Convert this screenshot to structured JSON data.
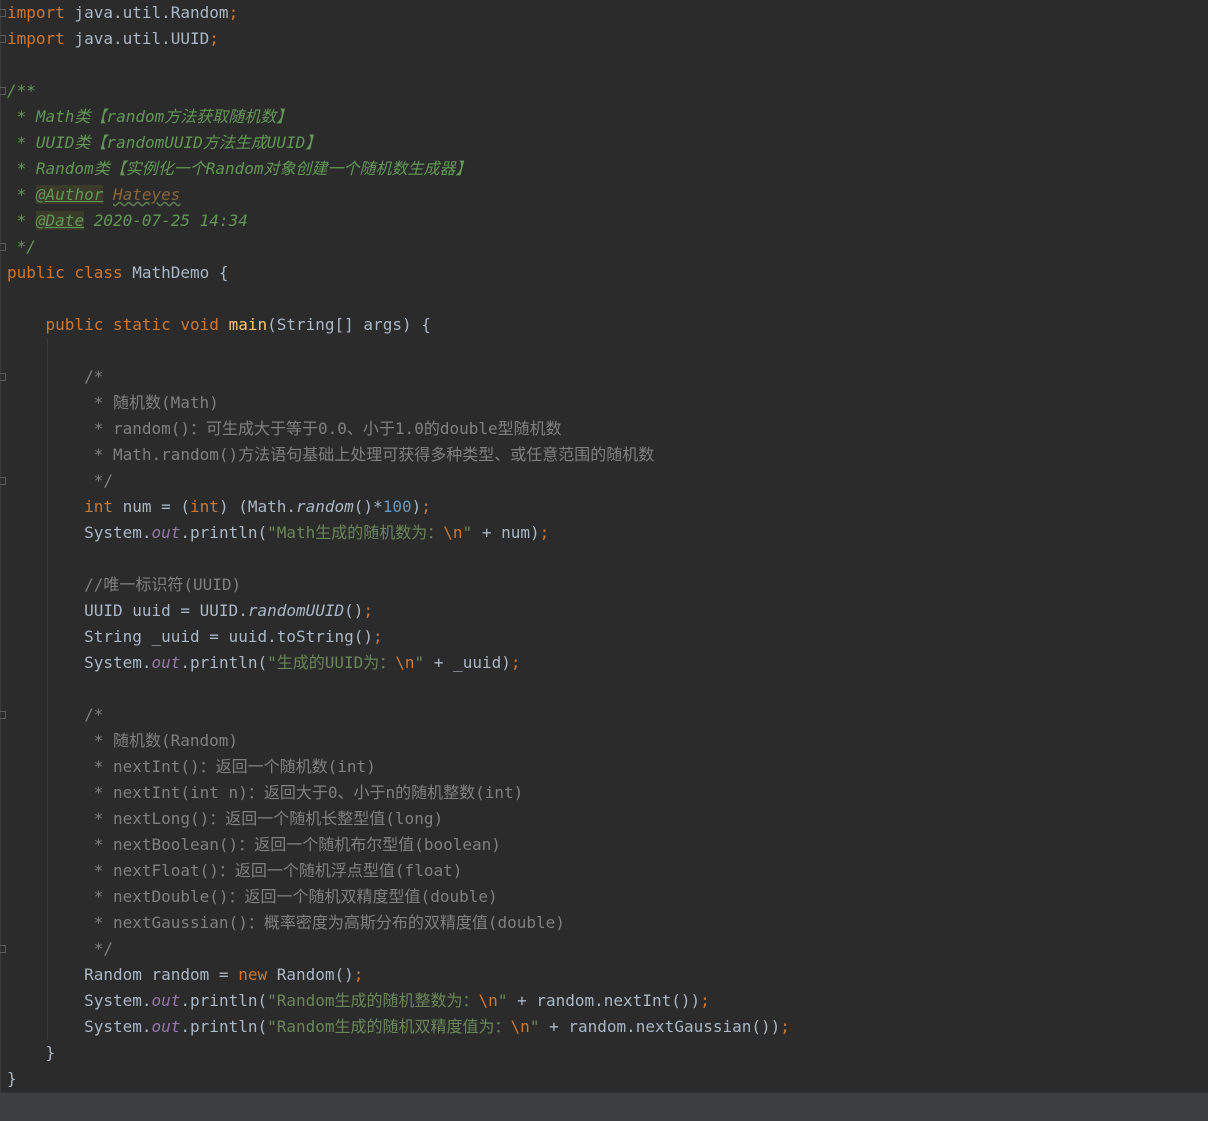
{
  "editor": {
    "lines": [
      [
        {
          "c": "kw",
          "t": "import"
        },
        {
          "c": "",
          "t": " java.util.Random"
        },
        {
          "c": "kw",
          "t": ";"
        }
      ],
      [
        {
          "c": "kw",
          "t": "import"
        },
        {
          "c": "",
          "t": " java.util.UUID"
        },
        {
          "c": "kw",
          "t": ";"
        }
      ],
      [],
      [
        {
          "c": "doc",
          "t": "/**"
        }
      ],
      [
        {
          "c": "doc",
          "t": " * Math类【random方法获取随机数】"
        }
      ],
      [
        {
          "c": "doc",
          "t": " * UUID类【randomUUID方法生成UUID】"
        }
      ],
      [
        {
          "c": "doc",
          "t": " * Random类【实例化一个Random对象创建一个随机数生成器】"
        }
      ],
      [
        {
          "c": "doc",
          "t": " * "
        },
        {
          "c": "doctag",
          "t": "@Author"
        },
        {
          "c": "doc",
          "t": " "
        },
        {
          "c": "docval",
          "t": "Hateyes"
        }
      ],
      [
        {
          "c": "doc",
          "t": " * "
        },
        {
          "c": "doctag",
          "t": "@Date"
        },
        {
          "c": "doc",
          "t": " 2020-07-25 14:34"
        }
      ],
      [
        {
          "c": "doc",
          "t": " */"
        }
      ],
      [
        {
          "c": "kw",
          "t": "public class"
        },
        {
          "c": "",
          "t": " MathDemo {"
        }
      ],
      [],
      [
        {
          "c": "",
          "t": "    "
        },
        {
          "c": "kw",
          "t": "public static void"
        },
        {
          "c": "",
          "t": " "
        },
        {
          "c": "fn",
          "t": "main"
        },
        {
          "c": "",
          "t": "(String[] args) {"
        }
      ],
      [],
      [
        {
          "c": "cmt",
          "t": "        /*"
        }
      ],
      [
        {
          "c": "cmt",
          "t": "         * 随机数(Math)"
        }
      ],
      [
        {
          "c": "cmt",
          "t": "         * random()：可生成大于等于0.0、小于1.0的double型随机数"
        }
      ],
      [
        {
          "c": "cmt",
          "t": "         * Math.random()方法语句基础上处理可获得多种类型、或任意范围的随机数"
        }
      ],
      [
        {
          "c": "cmt",
          "t": "         */"
        }
      ],
      [
        {
          "c": "",
          "t": "        "
        },
        {
          "c": "kw",
          "t": "int"
        },
        {
          "c": "",
          "t": " num = ("
        },
        {
          "c": "kw",
          "t": "int"
        },
        {
          "c": "",
          "t": ") (Math."
        },
        {
          "c": "ital",
          "t": "random"
        },
        {
          "c": "",
          "t": "()*"
        },
        {
          "c": "num",
          "t": "100"
        },
        {
          "c": "",
          "t": ")"
        },
        {
          "c": "kw",
          "t": ";"
        }
      ],
      [
        {
          "c": "",
          "t": "        System."
        },
        {
          "c": "static",
          "t": "out"
        },
        {
          "c": "",
          "t": ".println("
        },
        {
          "c": "str",
          "t": "\"Math生成的随机数为："
        },
        {
          "c": "kw",
          "t": "\\n"
        },
        {
          "c": "str",
          "t": "\""
        },
        {
          "c": "",
          "t": " + num)"
        },
        {
          "c": "kw",
          "t": ";"
        }
      ],
      [],
      [
        {
          "c": "cmt",
          "t": "        //唯一标识符(UUID)"
        }
      ],
      [
        {
          "c": "",
          "t": "        UUID uuid = UUID."
        },
        {
          "c": "ital",
          "t": "randomUUID"
        },
        {
          "c": "",
          "t": "()"
        },
        {
          "c": "kw",
          "t": ";"
        }
      ],
      [
        {
          "c": "",
          "t": "        String _uuid = uuid.toString()"
        },
        {
          "c": "kw",
          "t": ";"
        }
      ],
      [
        {
          "c": "",
          "t": "        System."
        },
        {
          "c": "static",
          "t": "out"
        },
        {
          "c": "",
          "t": ".println("
        },
        {
          "c": "str",
          "t": "\"生成的UUID为："
        },
        {
          "c": "kw",
          "t": "\\n"
        },
        {
          "c": "str",
          "t": "\""
        },
        {
          "c": "",
          "t": " + _uuid)"
        },
        {
          "c": "kw",
          "t": ";"
        }
      ],
      [],
      [
        {
          "c": "cmt",
          "t": "        /*"
        }
      ],
      [
        {
          "c": "cmt",
          "t": "         * 随机数(Random)"
        }
      ],
      [
        {
          "c": "cmt",
          "t": "         * nextInt()：返回一个随机数(int)"
        }
      ],
      [
        {
          "c": "cmt",
          "t": "         * nextInt(int n)：返回大于0、小于n的随机整数(int)"
        }
      ],
      [
        {
          "c": "cmt",
          "t": "         * nextLong()：返回一个随机长整型值(long)"
        }
      ],
      [
        {
          "c": "cmt",
          "t": "         * nextBoolean()：返回一个随机布尔型值(boolean)"
        }
      ],
      [
        {
          "c": "cmt",
          "t": "         * nextFloat()：返回一个随机浮点型值(float)"
        }
      ],
      [
        {
          "c": "cmt",
          "t": "         * nextDouble()：返回一个随机双精度型值(double)"
        }
      ],
      [
        {
          "c": "cmt",
          "t": "         * nextGaussian()：概率密度为高斯分布的双精度值(double)"
        }
      ],
      [
        {
          "c": "cmt",
          "t": "         */"
        }
      ],
      [
        {
          "c": "",
          "t": "        Random random = "
        },
        {
          "c": "kw",
          "t": "new"
        },
        {
          "c": "",
          "t": " Random()"
        },
        {
          "c": "kw",
          "t": ";"
        }
      ],
      [
        {
          "c": "",
          "t": "        System."
        },
        {
          "c": "static",
          "t": "out"
        },
        {
          "c": "",
          "t": ".println("
        },
        {
          "c": "str",
          "t": "\"Random生成的随机整数为："
        },
        {
          "c": "kw",
          "t": "\\n"
        },
        {
          "c": "str",
          "t": "\""
        },
        {
          "c": "",
          "t": " + random.nextInt())"
        },
        {
          "c": "kw",
          "t": ";"
        }
      ],
      [
        {
          "c": "",
          "t": "        System."
        },
        {
          "c": "static",
          "t": "out"
        },
        {
          "c": "",
          "t": ".println("
        },
        {
          "c": "str",
          "t": "\"Random生成的随机双精度值为："
        },
        {
          "c": "kw",
          "t": "\\n"
        },
        {
          "c": "str",
          "t": "\""
        },
        {
          "c": "",
          "t": " + random.nextGaussian())"
        },
        {
          "c": "kw",
          "t": ";"
        }
      ],
      [
        {
          "c": "",
          "t": "    }"
        }
      ],
      [
        {
          "c": "",
          "t": "}"
        }
      ]
    ]
  },
  "colors": {
    "background": "#2b2b2b",
    "keyword": "#cc7832",
    "string": "#6a8759",
    "number": "#6897bb",
    "method": "#ffc66d",
    "static_field": "#9876aa",
    "doc_comment": "#629755",
    "comment": "#808080",
    "text": "#a9b7c6"
  }
}
